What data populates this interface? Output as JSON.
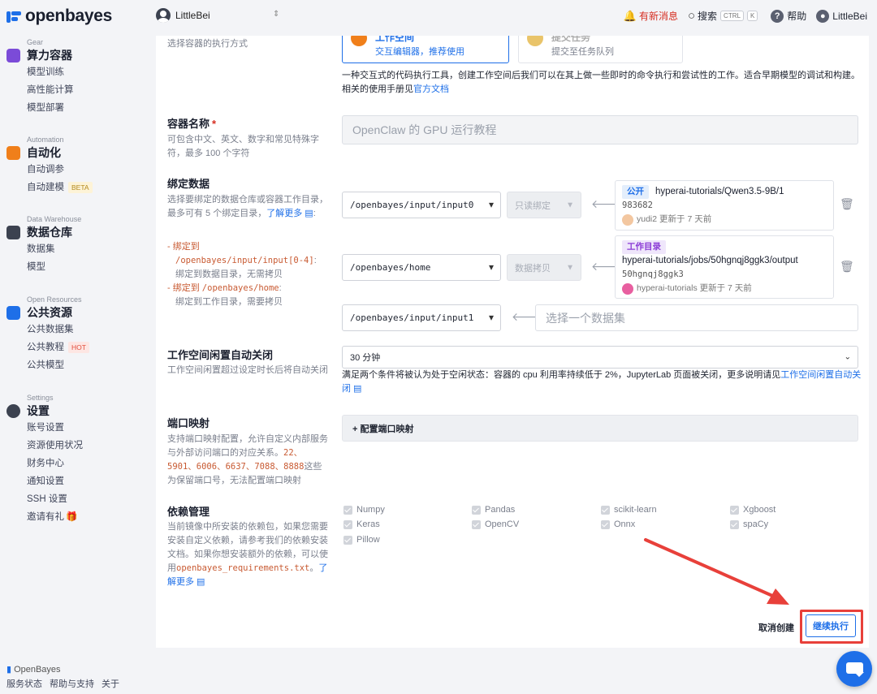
{
  "topbar": {
    "brand": "openbayes",
    "workspace": "LittleBei",
    "news": "有新消息",
    "search": "搜索",
    "kbd1": "CTRL",
    "kbd2": "K",
    "help": "帮助",
    "user": "LittleBei"
  },
  "sidebar": {
    "groups": [
      {
        "caption": "Gear",
        "title": "算力容器",
        "color": "#7b4bd8",
        "items": [
          "模型训练",
          "高性能计算",
          "模型部署"
        ]
      },
      {
        "caption": "Automation",
        "title": "自动化",
        "color": "#f07f1a",
        "items": [
          "自动调参",
          "自动建模"
        ],
        "beta": "BETA"
      },
      {
        "caption": "Data Warehouse",
        "title": "数据仓库",
        "color": "#3c4250",
        "items": [
          "数据集",
          "模型"
        ]
      },
      {
        "caption": "Open Resources",
        "title": "公共资源",
        "color": "#1e6fe8",
        "items": [
          "公共数据集",
          "公共教程",
          "公共模型"
        ],
        "hot": "HOT"
      },
      {
        "caption": "Settings",
        "title": "设置",
        "color": "#3c4250",
        "items": [
          "账号设置",
          "资源使用状况",
          "财务中心",
          "通知设置",
          "SSH 设置",
          "邀请有礼"
        ]
      }
    ],
    "footer_brand": "OpenBayes",
    "footer_links": [
      "服务状态",
      "帮助与支持",
      "关于"
    ]
  },
  "exec": {
    "desc": "选择容器的执行方式",
    "opt1_title": "工作空间",
    "opt1_sub": "交互编辑器，推荐使用",
    "opt2_title": "提交任务",
    "opt2_sub": "提交至任务队列",
    "note": "一种交互式的代码执行工具，创建工作空间后我们可以在其上做一些即时的命令执行和尝试性的工作。适合早期模型的调试和构建。相关的使用手册见",
    "note_link": "官方文档"
  },
  "name": {
    "label": "容器名称",
    "required": "*",
    "desc": "可包含中文、英文、数字和常见特殊字符，最多 100 个字符",
    "value": "OpenClaw 的 GPU 运行教程"
  },
  "bind": {
    "label": "绑定数据",
    "desc": "选择要绑定的数据仓库或容器工作目录，最多可有 5 个绑定目录，",
    "desc_link": "了解更多",
    "rule1a": "绑定到",
    "rule1b": "/openbayes/input/input[0-4]",
    "rule1c": ":",
    "rule1d": "绑定到数据目录，无需拷贝",
    "rule2a": "绑定到",
    "rule2b": "/openbayes/home",
    "rule2c": ":",
    "rule2d": "绑定到工作目录，需要拷贝",
    "rows": [
      {
        "path": "/openbayes/input/input0",
        "mode": "只读绑定",
        "pill": "公开",
        "name": "hyperai-tutorials/Qwen3.5-9B/1",
        "id": "983682",
        "owner": "yudi2",
        "updated": "更新于 7 天前"
      },
      {
        "path": "/openbayes/home",
        "mode": "数据拷贝",
        "pill": "工作目录",
        "name": "hyperai-tutorials/jobs/50hgnqj8ggk3/output",
        "id": "50hgnqj8ggk3",
        "owner": "hyperai-tutorials",
        "updated": "更新于 7 天前"
      },
      {
        "path": "/openbayes/input/input1",
        "placeholder": "选择一个数据集"
      }
    ]
  },
  "idle": {
    "label": "工作空间闲置自动关闭",
    "desc": "工作空间闲置超过设定时长后将自动关闭",
    "value": "30 分钟",
    "note": "满足两个条件将被认为处于空闲状态：容器的 cpu 利用率持续低于 2%，JupyterLab 页面被关闭，更多说明请见",
    "note_link": "工作空间闲置自动关闭"
  },
  "ports": {
    "label": "端口映射",
    "desc": "支持端口映射配置，允许自定义内部服务与外部访问端口的对应关系。",
    "nums": "22、5901、6006、6637、7088、8888",
    "desc2": "这些为保留端口号，无法配置端口映射",
    "button": "+ 配置端口映射"
  },
  "deps": {
    "label": "依赖管理",
    "desc": "当前镜像中所安装的依赖包，如果您需要安装自定义依赖，请参考我们的依赖安装文档。如果你想安装额外的依赖，可以使用",
    "file": "openbayes_requirements.txt",
    "dot": "。",
    "link": "了解更多",
    "packages": [
      "Numpy",
      "Pandas",
      "scikit-learn",
      "Xgboost",
      "Keras",
      "OpenCV",
      "Onnx",
      "spaCy",
      "Pillow"
    ]
  },
  "actions": {
    "cancel": "取消创建",
    "continue": "继续执行"
  },
  "colors": {
    "accent": "#1e6fe8",
    "highlight": "#e8403a"
  }
}
